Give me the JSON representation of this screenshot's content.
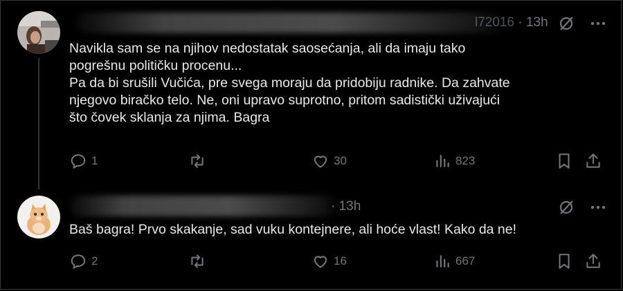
{
  "posts": [
    {
      "time": "13h",
      "handle_fragment": "l72016",
      "text_lines": [
        "Navikla sam se na njihov nedostatak saosećanja, ali da imaju tako",
        "pogrešnu političku procenu...",
        "Pa da bi srušili Vučića, pre svega moraju da pridobiju radnike. Da zahvate",
        "njegovo biračko telo. Ne, oni upravo suprotno, pritom sadistički uživajući",
        "što čovek sklanja za njima. Bagra"
      ],
      "replies": "1",
      "reposts": "",
      "likes": "30",
      "views": "823",
      "avatar_icon": "user-avatar-photo"
    },
    {
      "time": "13h",
      "text_lines": [
        "Baš bagra! Prvo skakanje, sad vuku kontejnere, ali hoće vlast! Kako da ne!"
      ],
      "replies": "2",
      "reposts": "",
      "likes": "16",
      "views": "667",
      "avatar_icon": "kitten-avatar"
    }
  ],
  "icons": {
    "grok": "grok-icon",
    "more": "more-icon",
    "reply": "reply-icon",
    "repost": "repost-icon",
    "like": "like-icon",
    "views": "views-icon",
    "bookmark": "bookmark-icon",
    "share": "share-icon"
  },
  "colors": {
    "background": "#000000",
    "text": "#e7e9ea",
    "muted": "#71767b"
  }
}
